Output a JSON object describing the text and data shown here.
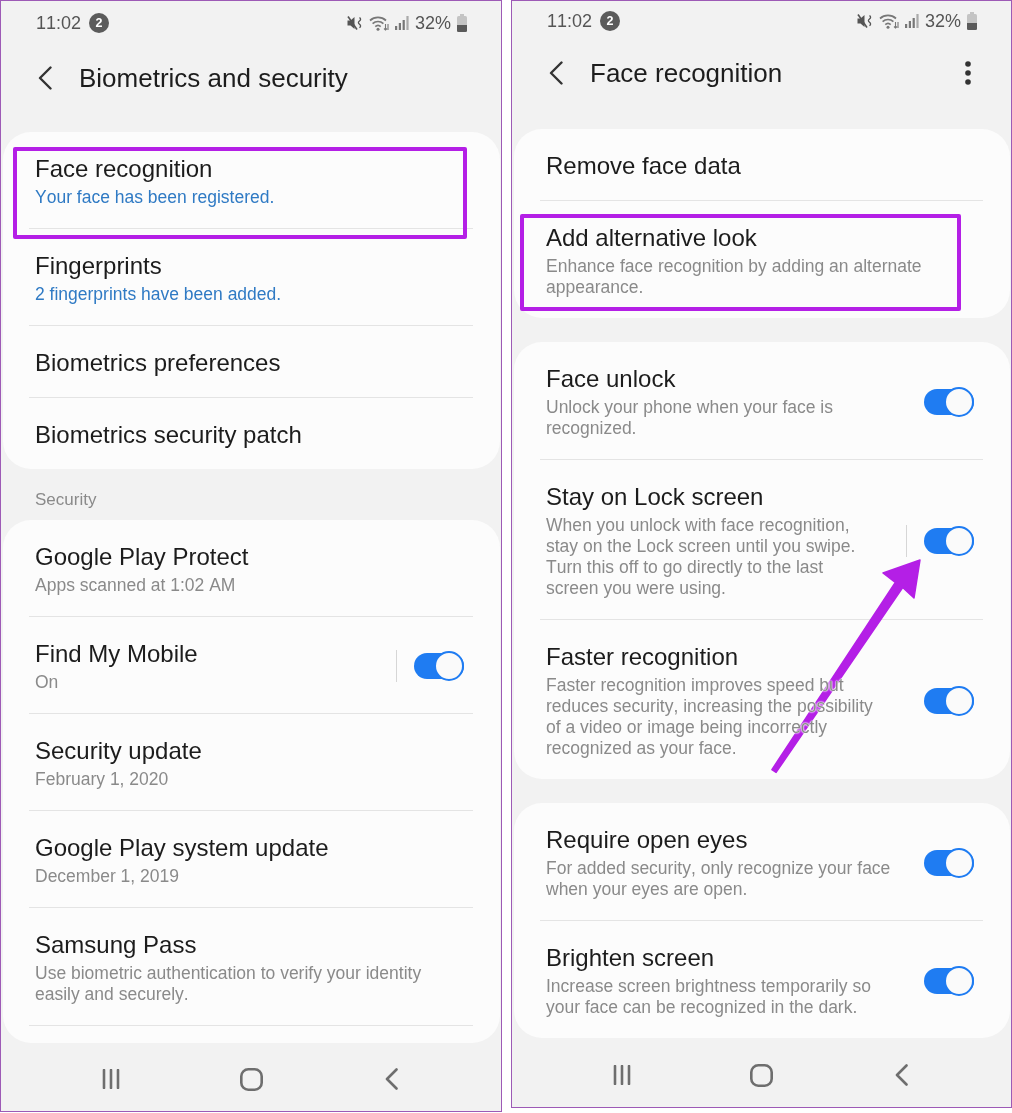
{
  "screens": [
    {
      "status_bar": {
        "time": "11:02",
        "notification_count": "2",
        "battery": "32%"
      },
      "header": {
        "title": "Biometrics and security",
        "more_menu": false
      },
      "sections": [
        {
          "continues": false,
          "items": [
            {
              "kind": "status",
              "title": "Face recognition",
              "subtitle": "Your face has been registered.",
              "highlighted": true
            },
            {
              "kind": "status",
              "title": "Fingerprints",
              "subtitle": "2 fingerprints have been added.",
              "highlighted": false
            },
            {
              "kind": "text",
              "title": "Biometrics preferences",
              "highlighted": false
            },
            {
              "kind": "text",
              "title": "Biometrics security patch",
              "highlighted": false
            }
          ]
        },
        {
          "header": "Security",
          "continues": true,
          "items": [
            {
              "kind": "text",
              "title": "Google Play Protect",
              "subtitle": "Apps scanned at 1:02 AM",
              "highlighted": false
            },
            {
              "kind": "toggle",
              "title": "Find My Mobile",
              "subtitle": "On",
              "on": true,
              "split": true,
              "pointed_at": false,
              "highlighted": false
            },
            {
              "kind": "text",
              "title": "Security update",
              "subtitle": "February 1, 2020",
              "highlighted": false
            },
            {
              "kind": "text",
              "title": "Google Play system update",
              "subtitle": "December 1, 2019",
              "highlighted": false
            },
            {
              "kind": "text",
              "title": "Samsung Pass",
              "subtitle": "Use biometric authentication to verify your identity easily and securely.",
              "highlighted": false
            }
          ]
        }
      ]
    },
    {
      "status_bar": {
        "time": "11:02",
        "notification_count": "2",
        "battery": "32%"
      },
      "header": {
        "title": "Face recognition",
        "more_menu": true
      },
      "sections": [
        {
          "continues": false,
          "items": [
            {
              "kind": "text",
              "title": "Remove face data",
              "highlighted": false
            },
            {
              "kind": "text",
              "title": "Add alternative look",
              "subtitle": "Enhance face recognition by adding an alternate appearance.",
              "highlighted": true
            }
          ]
        },
        {
          "continues": false,
          "items": [
            {
              "kind": "toggle",
              "title": "Face unlock",
              "subtitle": "Unlock your phone when your face is recognized.",
              "on": true,
              "split": false,
              "pointed_at": false,
              "highlighted": false
            },
            {
              "kind": "toggle",
              "title": "Stay on Lock screen",
              "subtitle": "When you unlock with face recognition, stay on the Lock screen until you swipe. Turn this off to go directly to the last screen you were using.",
              "on": true,
              "split": true,
              "pointed_at": true,
              "highlighted": false
            },
            {
              "kind": "toggle",
              "title": "Faster recognition",
              "subtitle": "Faster recognition improves speed but reduces security, increasing the possibility of a video or image being incorrectly recognized as your face.",
              "on": true,
              "split": false,
              "pointed_at": false,
              "highlighted": false
            }
          ]
        },
        {
          "continues": false,
          "items": [
            {
              "kind": "toggle",
              "title": "Require open eyes",
              "subtitle": "For added security, only recognize your face when your eyes are open.",
              "on": true,
              "split": false,
              "pointed_at": false,
              "highlighted": false
            },
            {
              "kind": "toggle",
              "title": "Brighten screen",
              "subtitle": "Increase screen brightness temporarily so your face can be recognized in the dark.",
              "on": true,
              "split": false,
              "pointed_at": false,
              "highlighted": false
            }
          ]
        }
      ]
    }
  ]
}
